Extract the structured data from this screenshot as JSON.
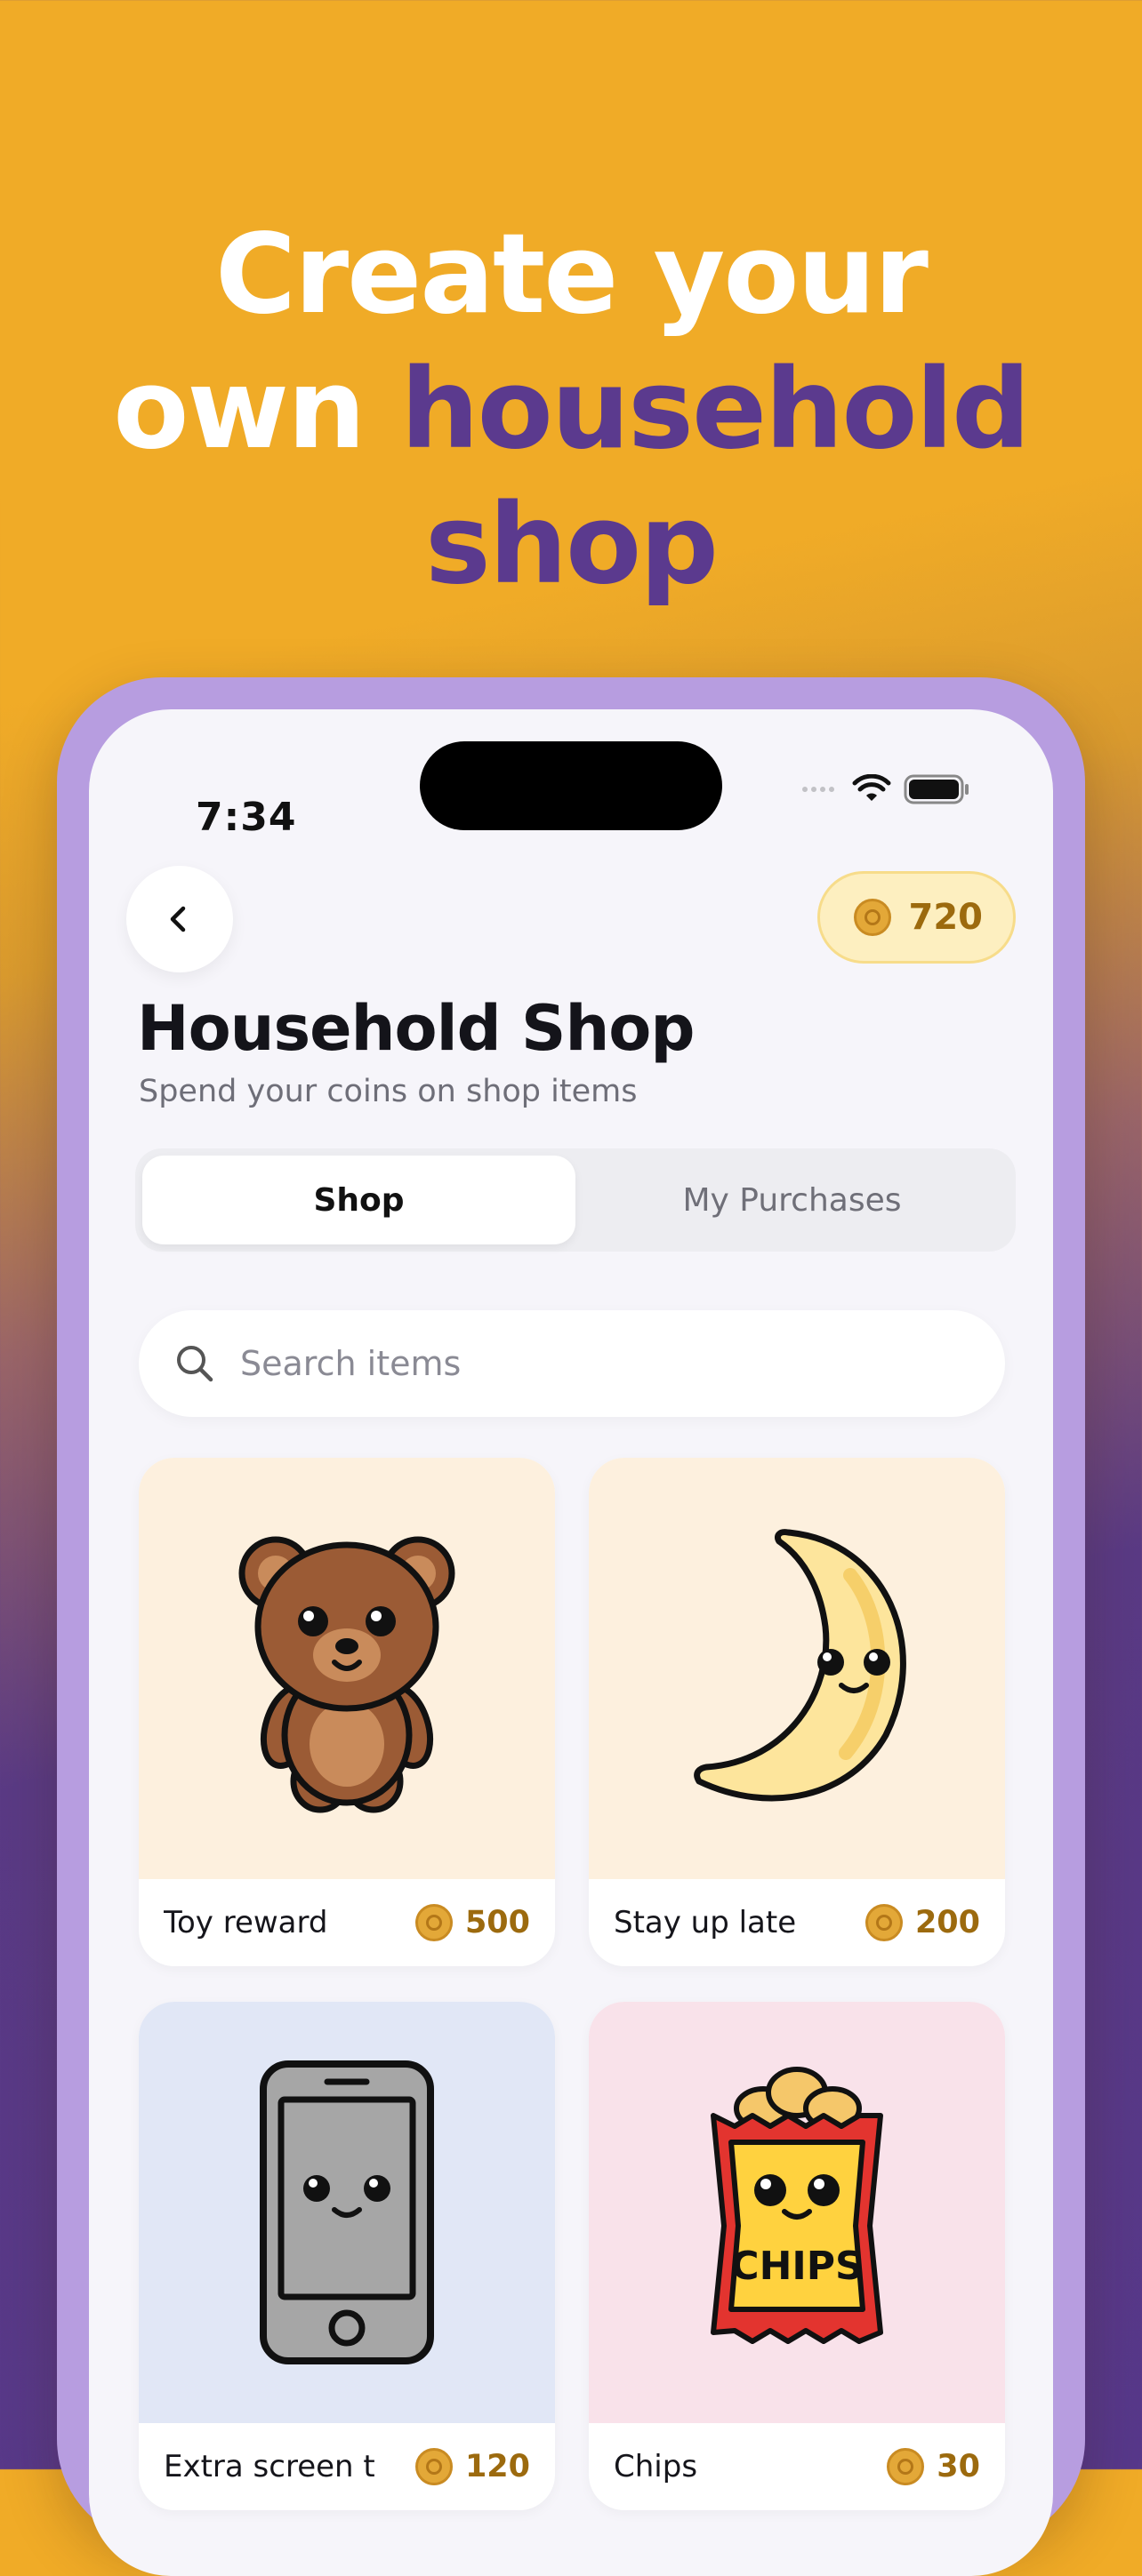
{
  "headline": {
    "line1": "Create your",
    "line2_prefix": "own ",
    "line2_highlight": "household",
    "line3": "shop"
  },
  "status_bar": {
    "time": "7:34"
  },
  "header": {
    "coin_balance": "720",
    "title": "Household Shop",
    "subtitle": "Spend your coins on shop items"
  },
  "tabs": [
    {
      "label": "Shop",
      "active": true
    },
    {
      "label": "My Purchases",
      "active": false
    }
  ],
  "search": {
    "placeholder": "Search items",
    "value": ""
  },
  "items": [
    {
      "name": "Toy reward",
      "price": "500",
      "icon": "teddy-bear-icon",
      "bg": "#FDF0DE"
    },
    {
      "name": "Stay up late",
      "price": "200",
      "icon": "moon-icon",
      "bg": "#FDF0DE"
    },
    {
      "name": "Extra screen t",
      "price": "120",
      "icon": "smartphone-icon",
      "bg": "#E1E7F6"
    },
    {
      "name": "Chips",
      "price": "30",
      "icon": "chips-bag-icon",
      "bg": "#F9E2EA"
    }
  ],
  "colors": {
    "brand_orange": "#F0AB27",
    "brand_purple": "#5B3A8E",
    "frame_lavender": "#B79DE0",
    "coin_text": "#9C6A0E"
  }
}
